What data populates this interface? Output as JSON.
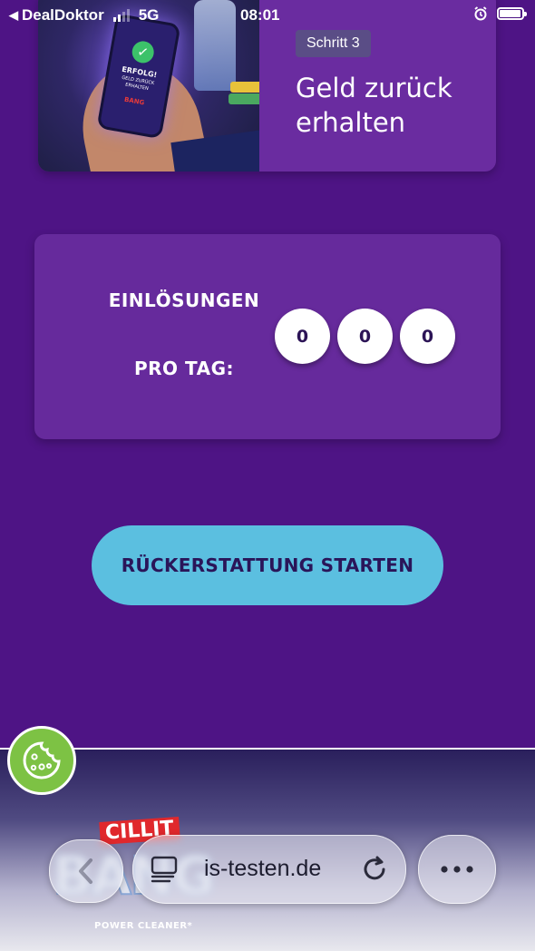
{
  "status_bar": {
    "back_app": "DealDoktor",
    "network": "5G",
    "time": "08:01"
  },
  "step_card": {
    "badge": "Schritt 3",
    "title": "Geld zurück erhalten",
    "image": {
      "phone_heading": "ERFOLG!",
      "phone_text": "GELD ZURÜCK ERHALTEN",
      "phone_brand": "BANG"
    }
  },
  "counter": {
    "label_line1": "EINLÖSUNGEN",
    "label_line2": "PRO TAG:",
    "digits": [
      "0",
      "0",
      "0"
    ]
  },
  "cta": {
    "label": "RÜCKERSTATTUNG STARTEN"
  },
  "brand": {
    "line1": "CILLIT",
    "line2": "BANG",
    "tagline": "POWER CLEANER*"
  },
  "browser": {
    "url": "is-testen.de"
  },
  "colors": {
    "background": "#4e1485",
    "card": "#662a9c",
    "cta": "#5bbfe0",
    "cta_text": "#2a1559",
    "cookie_button": "#7dc244"
  }
}
